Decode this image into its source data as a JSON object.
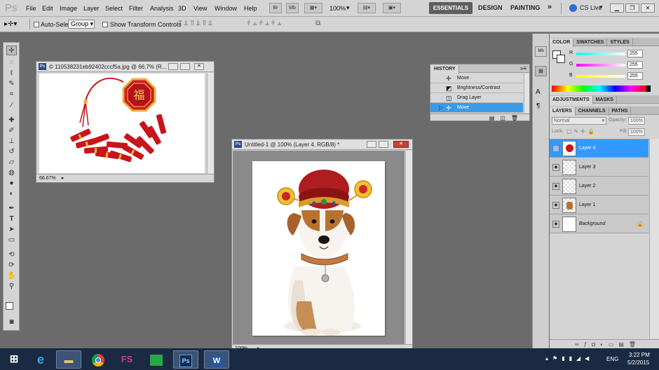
{
  "app": {
    "logo": "Ps",
    "name": "Adobe Photoshop CS5"
  },
  "menu": [
    "File",
    "Edit",
    "Image",
    "Layer",
    "Select",
    "Filter",
    "Analysis",
    "3D",
    "View",
    "Window",
    "Help"
  ],
  "topbar": {
    "mode_buttons": [
      "Br",
      "Mb"
    ],
    "zoom": "100%",
    "workspaces": {
      "essentials": "ESSENTIALS",
      "design": "DESIGN",
      "painting": "PAINTING",
      "more": "»"
    },
    "cs_live": "CS Live"
  },
  "options": {
    "auto_select_label": "Auto-Select:",
    "auto_select_value": "Group",
    "transform_label": "Show Transform Controls"
  },
  "doc1": {
    "title": "© 110538231eb92402cccf5a.jpg @ 66.7% (R...",
    "zoom": "66.67%"
  },
  "doc2": {
    "title": "Untitled-1 @ 100% (Layer 4, RGB/8) *",
    "zoom": "100%"
  },
  "history": {
    "title": "HISTORY",
    "items": [
      "Move",
      "Brightness/Contrast",
      "Drag Layer",
      "Move"
    ],
    "selected_index": 3
  },
  "color_panel": {
    "tabs": [
      "COLOR",
      "SWATCHES",
      "STYLES"
    ],
    "r_label": "R",
    "g_label": "G",
    "b_label": "B",
    "r": "255",
    "g": "255",
    "b": "255"
  },
  "adjustments": {
    "tabs": [
      "ADJUSTMENTS",
      "MASKS"
    ]
  },
  "layers_panel": {
    "tabs": [
      "LAYERS",
      "CHANNELS",
      "PATHS"
    ],
    "blend_mode": "Normal",
    "opacity_label": "Opacity:",
    "opacity": "100%",
    "lock_label": "Lock:",
    "fill_label": "Fill:",
    "fill": "100%",
    "layers": [
      "Layer 4",
      "Layer 3",
      "Layer 2",
      "Layer 1",
      "Background"
    ],
    "selected_index": 0
  },
  "taskbar": {
    "lang": "ENG",
    "time": "3:22 PM",
    "date": "5/2/2015",
    "apps": [
      "windows-start",
      "internet-explorer",
      "file-explorer",
      "chrome",
      "fs-app",
      "store",
      "photoshop",
      "word"
    ]
  },
  "colors": {
    "accent": "#3399ff",
    "panel": "#d4d4d4",
    "canvas_bg": "#6b6b6b",
    "hist_select": "#3a9be8"
  }
}
